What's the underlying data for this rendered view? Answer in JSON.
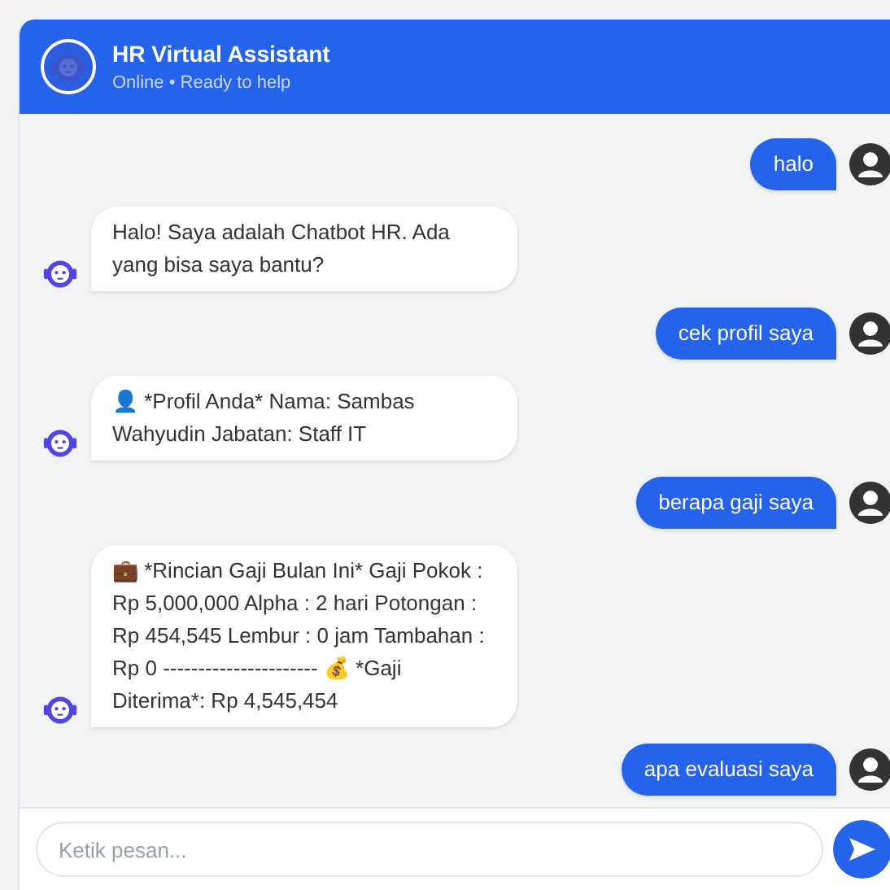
{
  "header": {
    "title": "HR Virtual Assistant",
    "subtitle": "Online • Ready to help"
  },
  "messages": [
    {
      "kind": "user",
      "text": "halo"
    },
    {
      "kind": "bot",
      "text": "Halo! Saya adalah Chatbot HR. Ada yang bisa saya bantu?"
    },
    {
      "kind": "user",
      "text": "cek profil saya"
    },
    {
      "kind": "bot",
      "text": "👤 *Profil Anda* Nama: Sambas Wahyudin Jabatan: Staff IT"
    },
    {
      "kind": "user",
      "text": "berapa gaji saya"
    },
    {
      "kind": "bot",
      "text": "💼 *Rincian Gaji Bulan Ini* Gaji Pokok : Rp 5,000,000 Alpha : 2 hari Potongan : Rp 454,545 Lembur : 0 jam Tambahan : Rp 0 ---------------------- 💰 *Gaji Diterima*: Rp 4,545,454"
    },
    {
      "kind": "user",
      "text": "apa evaluasi saya"
    }
  ],
  "input": {
    "placeholder": "Ketik pesan..."
  }
}
